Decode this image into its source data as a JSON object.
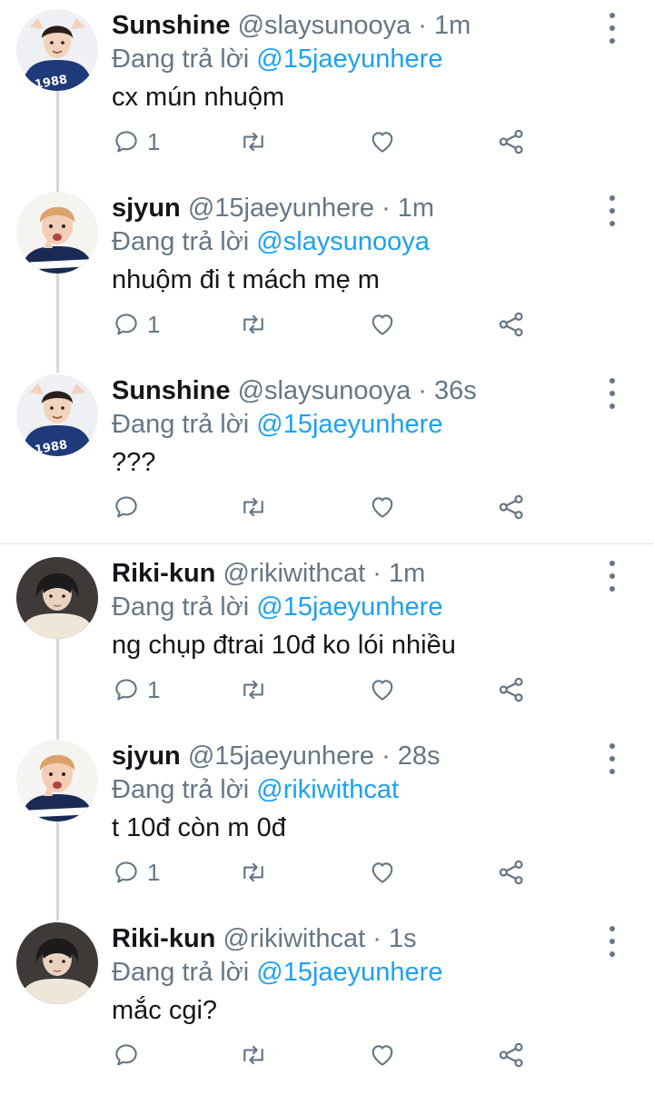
{
  "tweets": [
    {
      "name": "Sunshine",
      "handle": "@slaysunooya",
      "time": "1m",
      "replying_label": "Đang trả lời",
      "reply_to": "@15jaeyunhere",
      "text": "cx mún nhuộm",
      "reply_count": "1",
      "avatar": "sunshine"
    },
    {
      "name": "sjyun",
      "handle": "@15jaeyunhere",
      "time": "1m",
      "replying_label": "Đang trả lời",
      "reply_to": "@slaysunooya",
      "text": "nhuộm đi t mách mẹ m",
      "reply_count": "1",
      "avatar": "sjyun"
    },
    {
      "name": "Sunshine",
      "handle": "@slaysunooya",
      "time": "36s",
      "replying_label": "Đang trả lời",
      "reply_to": "@15jaeyunhere",
      "text": "???",
      "reply_count": "",
      "avatar": "sunshine"
    },
    {
      "name": "Riki-kun",
      "handle": "@rikiwithcat",
      "time": "1m",
      "replying_label": "Đang trả lời",
      "reply_to": "@15jaeyunhere",
      "text": "ng chụp đtrai 10đ ko lói nhiều",
      "reply_count": "1",
      "avatar": "riki"
    },
    {
      "name": "sjyun",
      "handle": "@15jaeyunhere",
      "time": "28s",
      "replying_label": "Đang trả lời",
      "reply_to": "@rikiwithcat",
      "text": "t 10đ còn m 0đ",
      "reply_count": "1",
      "avatar": "sjyun"
    },
    {
      "name": "Riki-kun",
      "handle": "@rikiwithcat",
      "time": "1s",
      "replying_label": "Đang trả lời",
      "reply_to": "@15jaeyunhere",
      "text": "mắc cgi?",
      "reply_count": "",
      "avatar": "riki"
    }
  ],
  "avatar_text": {
    "sunshine": "1988"
  },
  "icons": {
    "reply": "reply-icon",
    "retweet": "retweet-icon",
    "like": "heart-icon",
    "share": "share-icon",
    "more": "more-vertical-icon"
  },
  "colors": {
    "accent": "#1da1f2",
    "muted": "#657786",
    "text": "#14171a",
    "thread_line": "#cfd9de"
  }
}
